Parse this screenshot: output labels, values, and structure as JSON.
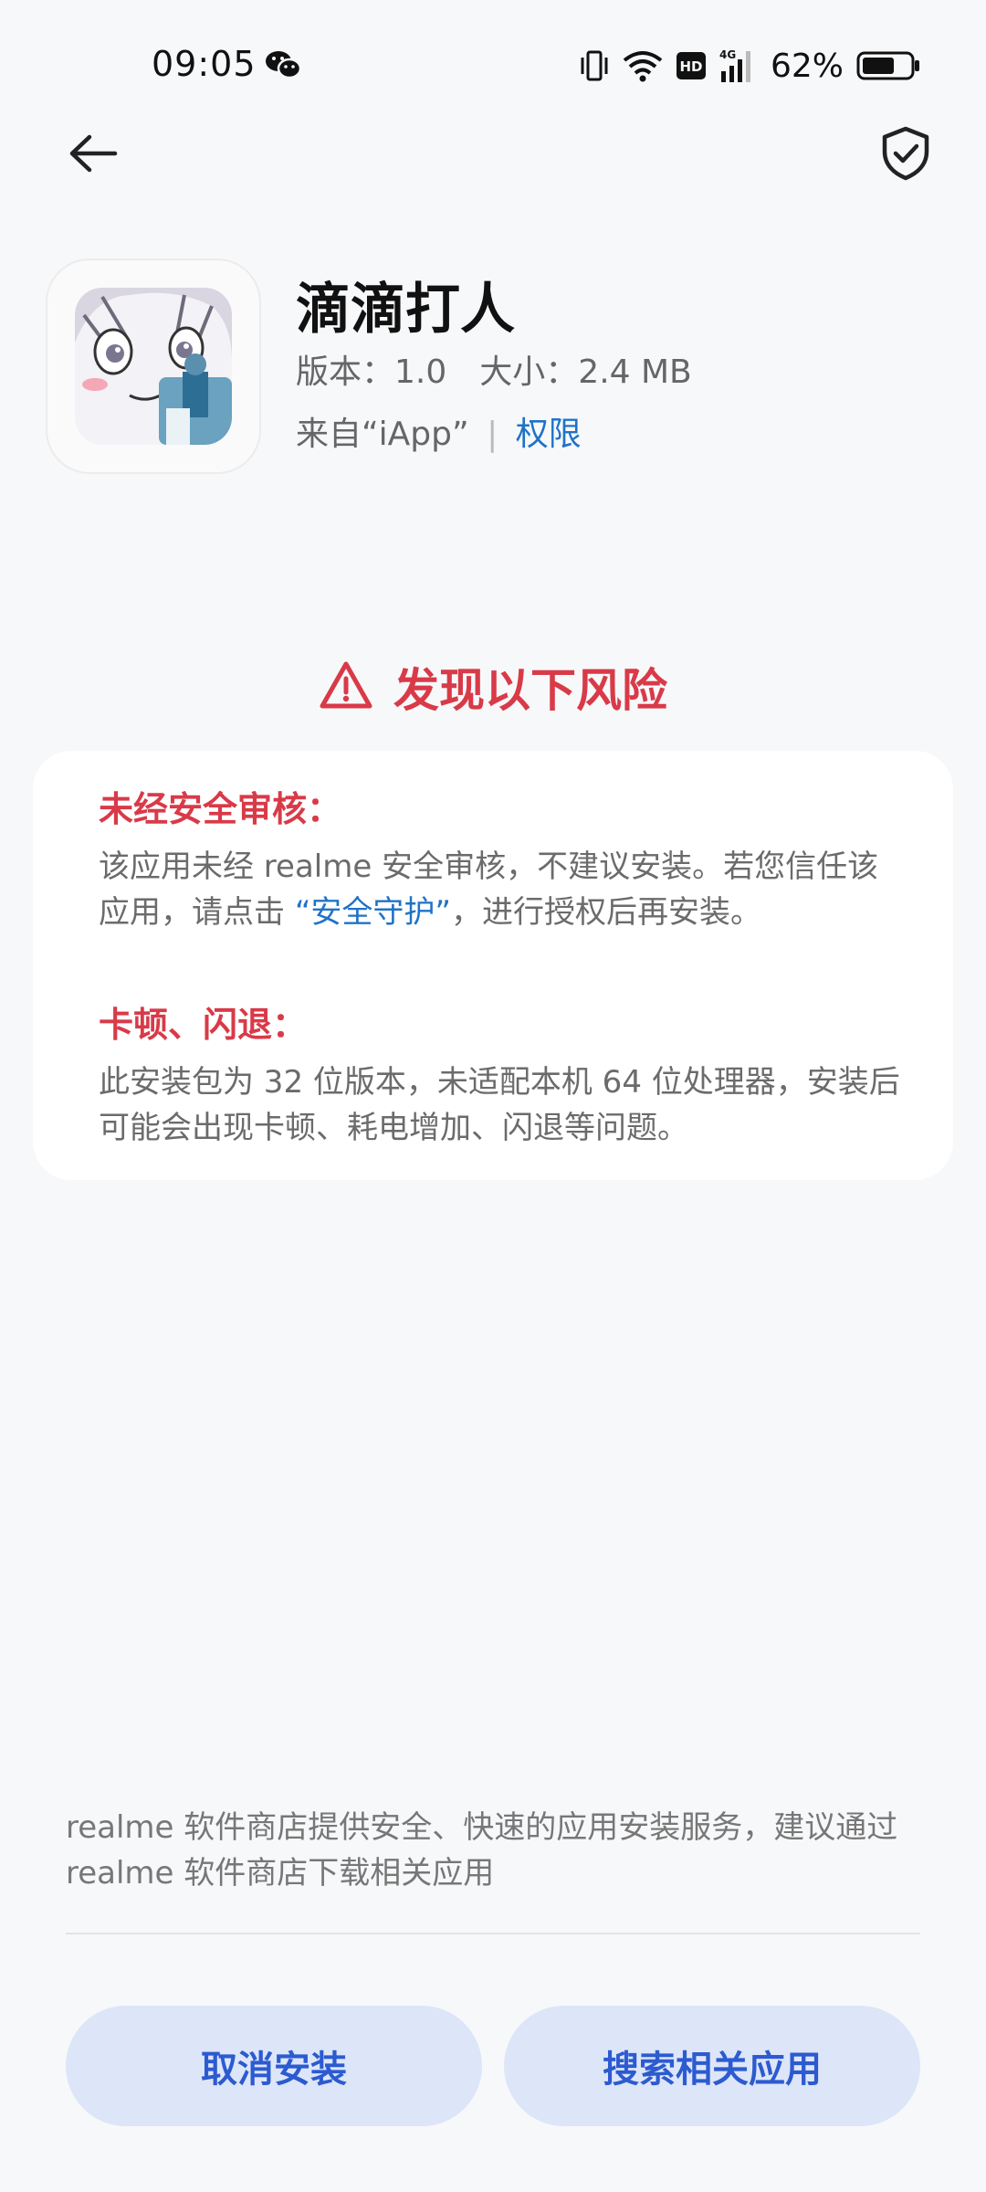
{
  "status_bar": {
    "time": "09:05",
    "battery": "62%",
    "icons": [
      "wechat-icon",
      "vibrate-icon",
      "wifi-icon",
      "hd-icon",
      "4g-signal-icon",
      "battery-icon"
    ]
  },
  "nav": {
    "back_icon": "arrow-left-icon",
    "shield_icon": "shield-check-icon"
  },
  "app": {
    "name": "滴滴打人",
    "version_label": "版本：",
    "version": "1.0",
    "size_label": "大小：",
    "size": "2.4 MB",
    "source": "来自“iApp”",
    "divider": "|",
    "permissions_link": "权限"
  },
  "risk": {
    "header": "发现以下风险",
    "items": [
      {
        "title": "未经安全审核：",
        "desc_before": "该应用未经 realme 安全审核，不建议安装。若您信任该应用，请点击 ",
        "desc_link": "“安全守护”",
        "desc_after": "，进行授权后再安装。"
      },
      {
        "title": "卡顿、闪退：",
        "desc": "此安装包为 32 位版本，未适配本机 64 位处理器，安装后可能会出现卡顿、耗电增加、闪退等问题。"
      }
    ]
  },
  "footer": {
    "note": "realme 软件商店提供安全、快速的应用安装服务，建议通过 realme 软件商店下载相关应用"
  },
  "buttons": {
    "cancel": "取消安装",
    "search": "搜索相关应用"
  },
  "colors": {
    "risk_red": "#d93a48",
    "link_blue": "#1f73c7",
    "button_bg": "#dde5f8",
    "button_text": "#2c5bd0"
  }
}
